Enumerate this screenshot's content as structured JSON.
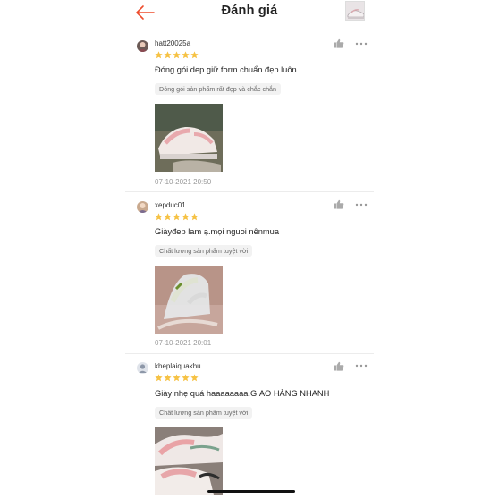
{
  "header": {
    "title": "Đánh giá",
    "back_icon": "arrow-left-icon",
    "accent": "#ee4d2d"
  },
  "reviews": [
    {
      "username": "hatt20025a",
      "rating": 5,
      "text": "Đóng gói dep.giữ form chuẩn đẹp luôn",
      "tag": "Đóng gói sản phẩm rất đẹp và chắc chắn",
      "date": "07-10-2021 20:50"
    },
    {
      "username": "xepduc01",
      "rating": 5,
      "text": "Giàyđep lam ạ.mọi nguoi nênmua",
      "tag": "Chất lượng sản phẩm tuyệt vời",
      "date": "07-10-2021 20:01"
    },
    {
      "username": "kheplaiquakhu",
      "rating": 5,
      "text": "Giày nhẹ quá haaaaaaaa.GIAO HÀNG NHANH",
      "tag": "Chất lượng sản phẩm tuyệt vời",
      "date": ""
    }
  ],
  "colors": {
    "star": "#f6c244",
    "icon_gray": "#aaaaaa"
  }
}
